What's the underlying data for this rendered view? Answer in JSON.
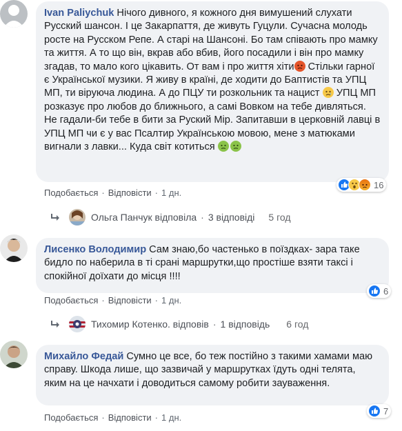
{
  "comments": [
    {
      "author": "Ivan Paliychuk",
      "segments": [
        "Нічого дивного, я кожного дня вимушений слухати Русский шансон. І це Закарпаття, де живуть Гуцули. Сучасна молодь росте на Русском Репе. А старі на Шансоні. Бо там співають про мамку та життя. А то що він, вкрав або вбив, його посадили і він про мамку згадав, то мало кого цікавить. От вам і про життя хіти",
        " Стільки гарної є Української музики. Я живу в країні, де ходити до Баптистів та УПЦ МП, ти віруюча людина. А до ПЦУ ти розкольник та нацист ",
        " УПЦ МП розказує про любов до ближнього, а самі Вовком на тебе дивляться. Не гадали-би тебе в бити за Руский Мір. Запитавши в церковній лавці в УПЦ МП чи є у вас Псалтир Українською мовою, мене з матюками вигнали з лавки... Куда світ котиться "
      ],
      "like": "Подобається",
      "reply": "Відповісти",
      "time": "1 дн.",
      "reactions_count": "16",
      "replies": {
        "name": "Ольга Панчук відповіла",
        "count": "3 відповіді",
        "time": "5 год"
      }
    },
    {
      "author": "Лисенко Володимир",
      "text": "Сам знаю,бо частенько в поїздках- зара таке бидло по наберила в ті срані маршрутки,що простіше взяти таксі і спокійної доїхати до місця !!!!",
      "like": "Подобається",
      "reply": "Відповісти",
      "time": "1 дн.",
      "reactions_count": "6",
      "replies": {
        "name": "Тихомир Котенко. відповів",
        "count": "1 відповідь",
        "time": "6 год"
      }
    },
    {
      "author": "Михайло Федай",
      "text": "Сумно це все, бо теж постійно з такими хамами маю справу. Шкода лише, що зазвичай у маршрутках їдуть одні телята, яким на це начхати і доводиться самому робити зауваження.",
      "like": "Подобається",
      "reply": "Відповісти",
      "time": "1 дн.",
      "reactions_count": "7"
    }
  ],
  "icons": {
    "angry": "angry-face-emoji",
    "sad": "sad-face-emoji",
    "nauseated": "nauseated-face-emoji",
    "like": "like-reaction",
    "wow": "wow-reaction",
    "reply_arrow": "reply-arrow-icon"
  },
  "colors": {
    "link": "#385898",
    "bubble": "#f0f2f5",
    "like_blue": "#1877f2"
  }
}
